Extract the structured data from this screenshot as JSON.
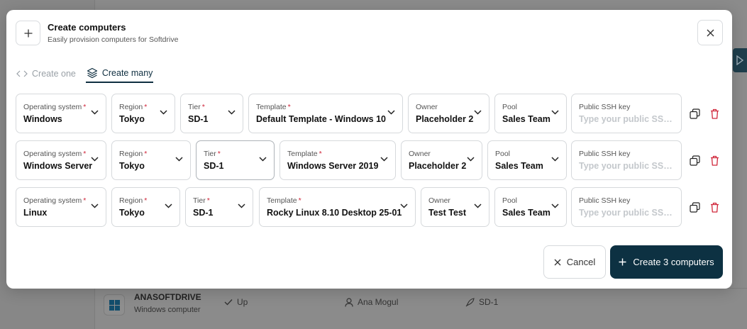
{
  "background": {
    "computer": {
      "name": "ANASOFTDRIVE",
      "subtitle": "Windows computer",
      "status": "Up",
      "user": "Ana Mogul",
      "tier": "SD-1"
    }
  },
  "modal": {
    "title": "Create computers",
    "subtitle": "Easily provision computers for Softdrive",
    "tabs": [
      {
        "label": "Create one",
        "icon": "code-icon",
        "active": false
      },
      {
        "label": "Create many",
        "icon": "layers-icon",
        "active": true
      }
    ],
    "labels": {
      "os": "Operating system",
      "region": "Region",
      "tier": "Tier",
      "template": "Template",
      "owner": "Owner",
      "pool": "Pool",
      "ssh": "Public SSH key",
      "required_mark": "*"
    },
    "ssh_placeholder": "Type your public SSH key",
    "rows": [
      {
        "os": "Windows",
        "region": "Tokyo",
        "tier": "SD-1",
        "template": "Default Template - Windows 10",
        "owner": "Placeholder 2",
        "pool": "Sales Team",
        "ssh": ""
      },
      {
        "os": "Windows Server",
        "region": "Tokyo",
        "tier": "SD-1",
        "template": "Windows Server 2019",
        "owner": "Placeholder 2",
        "pool": "Sales Team",
        "ssh": ""
      },
      {
        "os": "Linux",
        "region": "Tokyo",
        "tier": "SD-1",
        "template": "Rocky Linux 8.10 Desktop 25-01",
        "owner": "Test Test",
        "pool": "Sales Team",
        "ssh": ""
      }
    ],
    "cancel_label": "Cancel",
    "create_label": "Create 3 computers"
  },
  "colors": {
    "primary": "#0d3142",
    "danger": "#d0263a",
    "border": "#d6d9dc"
  }
}
